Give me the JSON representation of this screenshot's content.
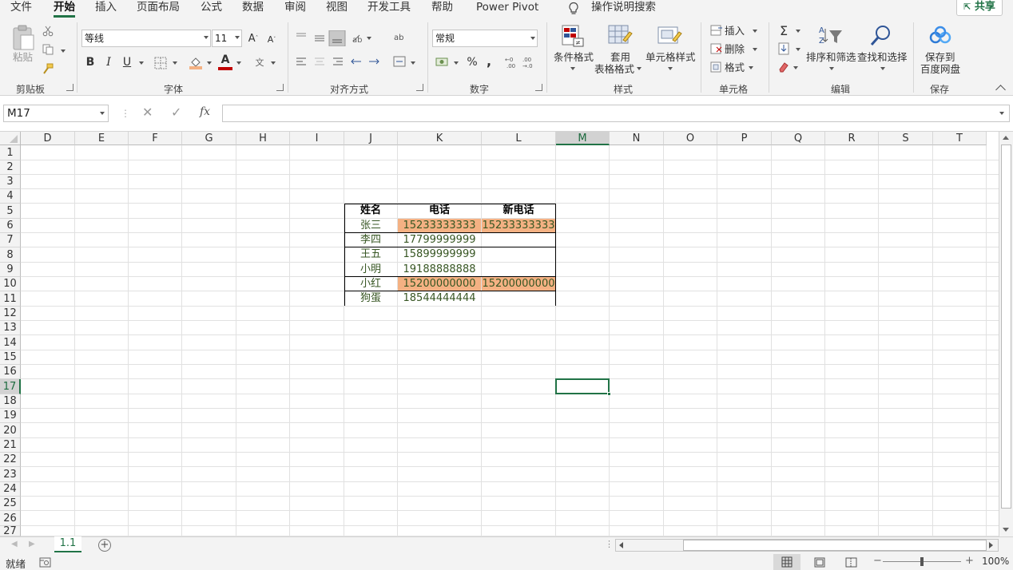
{
  "menu": {
    "tabs": [
      "文件",
      "开始",
      "插入",
      "页面布局",
      "公式",
      "数据",
      "审阅",
      "视图",
      "开发工具",
      "帮助",
      "Power Pivot"
    ],
    "active_tab": "开始",
    "tell_me": "操作说明搜索",
    "share": "共享"
  },
  "ribbon": {
    "clipboard": {
      "label": "剪贴板",
      "paste": "粘贴"
    },
    "font": {
      "label": "字体",
      "name": "等线",
      "size": "11",
      "bold": "B",
      "italic": "I",
      "underline": "U"
    },
    "alignment": {
      "label": "对齐方式"
    },
    "number": {
      "label": "数字",
      "format": "常规",
      "percent": "%",
      "comma": ","
    },
    "styles": {
      "label": "样式",
      "conditional": "条件格式",
      "table_format_1": "套用",
      "table_format_2": "表格格式",
      "cell_styles": "单元格样式"
    },
    "cells": {
      "label": "单元格",
      "insert": "插入",
      "delete": "删除",
      "format": "格式"
    },
    "editing": {
      "label": "编辑",
      "sum": "Σ",
      "sort_filter": "排序和筛选",
      "find_select": "查找和选择"
    },
    "save": {
      "label": "保存",
      "line1": "保存到",
      "line2": "百度网盘"
    }
  },
  "formula_bar": {
    "name_box": "M17",
    "fx": "fx",
    "formula": ""
  },
  "columns": [
    "D",
    "E",
    "F",
    "G",
    "H",
    "I",
    "J",
    "K",
    "L",
    "M",
    "N",
    "O",
    "P",
    "Q",
    "R",
    "S",
    "T"
  ],
  "selected_column": "M",
  "rows": [
    "1",
    "2",
    "3",
    "4",
    "5",
    "6",
    "7",
    "8",
    "9",
    "10",
    "11",
    "12",
    "13",
    "14",
    "15",
    "16",
    "17",
    "18",
    "19",
    "20",
    "21",
    "22",
    "23",
    "24",
    "25",
    "26",
    "27"
  ],
  "selected_row": "17",
  "table": {
    "headers": [
      "姓名",
      "电话",
      "新电话"
    ],
    "rows": [
      {
        "name": "张三",
        "phone": "15233333333",
        "new_phone": "15233333333",
        "highlight": true
      },
      {
        "name": "李四",
        "phone": "17799999999",
        "new_phone": "",
        "highlight": false
      },
      {
        "name": "王五",
        "phone": "15899999999",
        "new_phone": "",
        "highlight": false
      },
      {
        "name": "小明",
        "phone": "19188888888",
        "new_phone": "",
        "highlight": false
      },
      {
        "name": "小红",
        "phone": "15200000000",
        "new_phone": "15200000000",
        "highlight": true
      },
      {
        "name": "狗蛋",
        "phone": "18544444444",
        "new_phone": "",
        "highlight": false
      }
    ],
    "highlight_color": "#f4b183",
    "text_color": "#375623"
  },
  "sheet_tabs": [
    "1.1"
  ],
  "status": {
    "ready": "就绪",
    "zoom": "100%"
  },
  "accent_color": "#217346"
}
